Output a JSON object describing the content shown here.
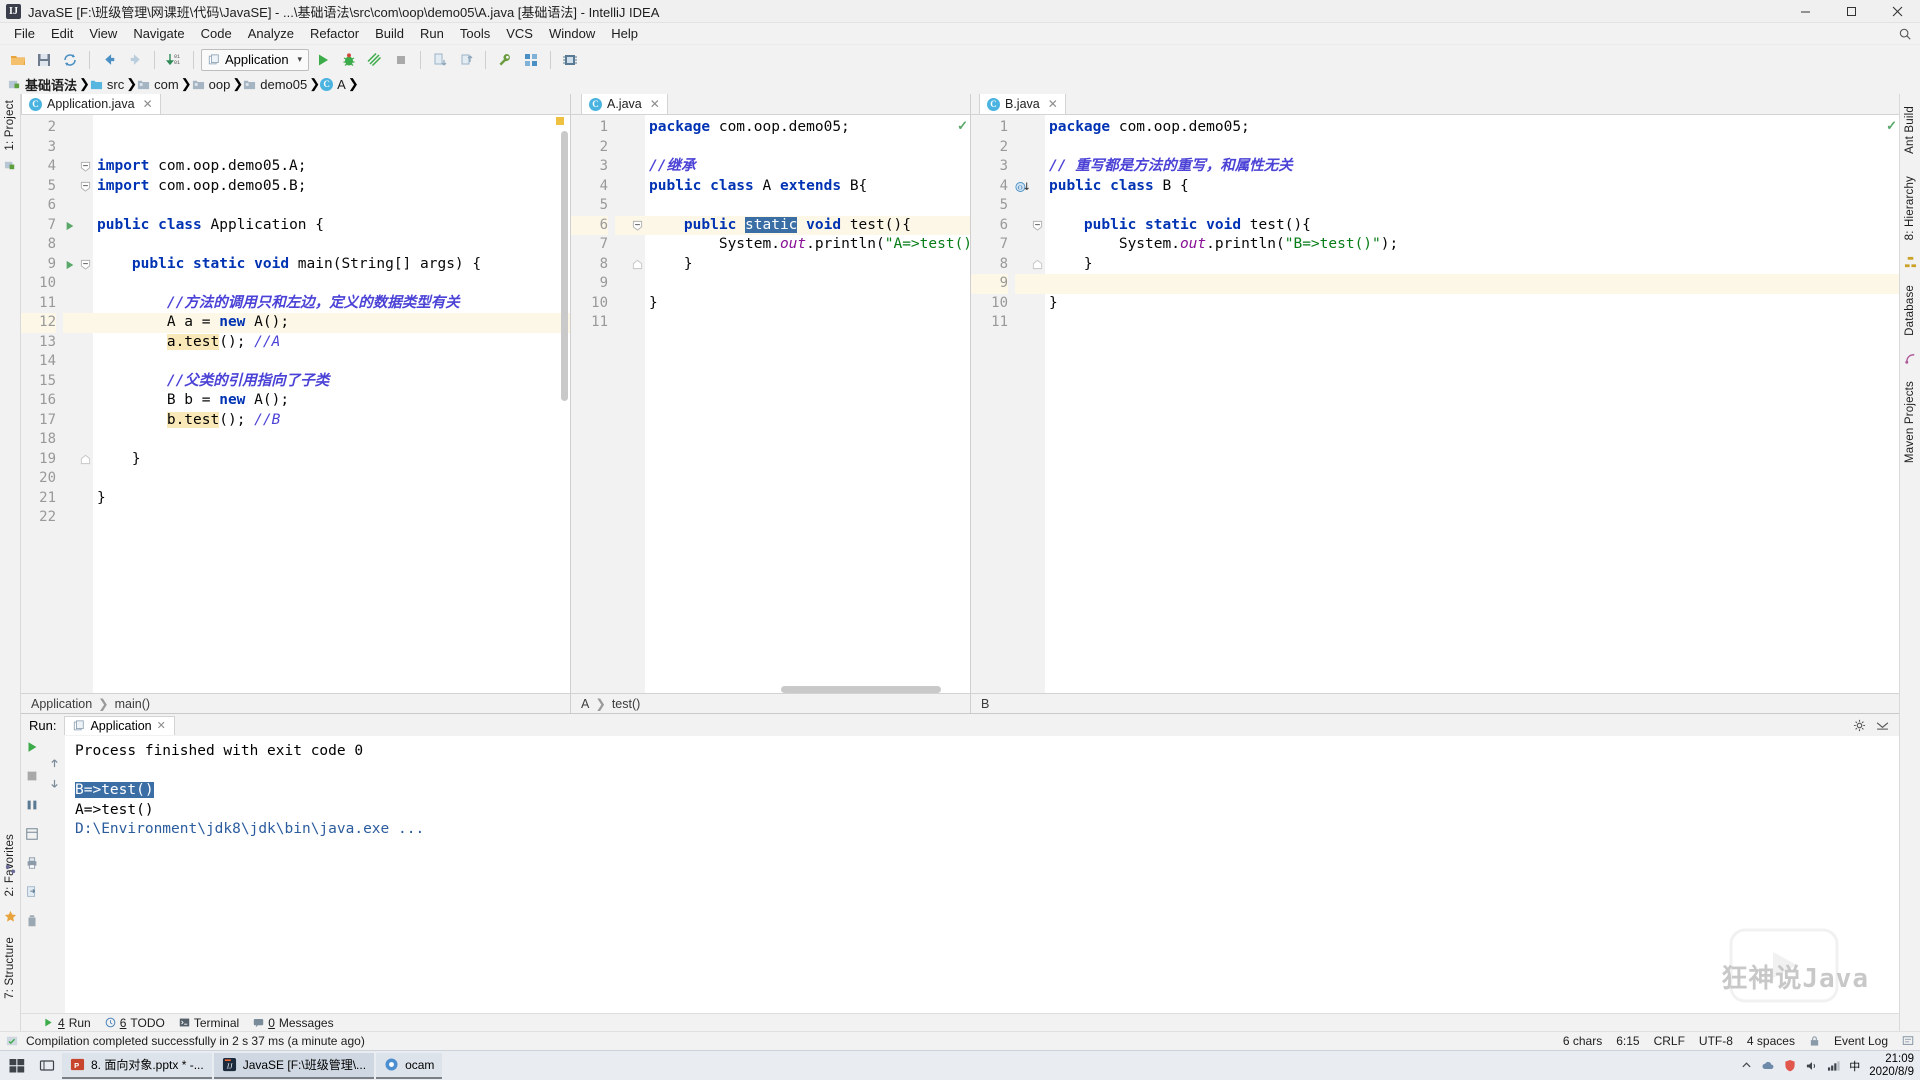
{
  "window": {
    "title": "JavaSE [F:\\班级管理\\网课班\\代码\\JavaSE] - ...\\基础语法\\src\\com\\oop\\demo05\\A.java [基础语法] - IntelliJ IDEA",
    "app_icon": "intellij-idea-icon",
    "minimize": "minimize-icon",
    "maximize": "maximize-icon",
    "close": "close-icon"
  },
  "menubar": {
    "items": [
      "File",
      "Edit",
      "View",
      "Navigate",
      "Code",
      "Analyze",
      "Refactor",
      "Build",
      "Run",
      "Tools",
      "VCS",
      "Window",
      "Help"
    ],
    "search_icon": "search-everywhere-icon"
  },
  "toolbar": {
    "run_config": "Application",
    "buttons": [
      "open-folder-icon",
      "save-all-icon",
      "sync-icon",
      "back-arrow-icon",
      "forward-arrow-icon",
      "compile-icon",
      "run-icon",
      "debug-icon",
      "run-coverage-icon",
      "stop-icon",
      "update-project-icon",
      "commit-icon",
      "settings-wrench-icon",
      "project-structure-icon",
      "sdk-manager-icon"
    ]
  },
  "breadcrumb": {
    "items": [
      {
        "label": "基础语法",
        "icon": "module-icon",
        "bold": true
      },
      {
        "label": "src",
        "icon": "source-folder-icon",
        "bold": false
      },
      {
        "label": "com",
        "icon": "package-folder-icon",
        "bold": false
      },
      {
        "label": "oop",
        "icon": "package-folder-icon",
        "bold": false
      },
      {
        "label": "demo05",
        "icon": "package-folder-icon",
        "bold": false
      },
      {
        "label": "A",
        "icon": "java-class-icon",
        "bold": false
      }
    ]
  },
  "left_strip": {
    "project_label": "1: Project",
    "structure_label": "7: Structure",
    "favorites_label": "2: Favorites"
  },
  "right_strip": {
    "ant_label": "Ant Build",
    "hierarchy_label": "8: Hierarchy",
    "database_label": "Database",
    "maven_label": "Maven Projects"
  },
  "editors": [
    {
      "tab": "Application.java",
      "tab_icon": "java-class-run-icon",
      "breadcrumb": [
        "Application",
        "main()"
      ],
      "first_line": 2,
      "lines": [
        {
          "n": 2,
          "fold": "",
          "gutter": "",
          "hl": false,
          "tokens": []
        },
        {
          "n": 3,
          "fold": "",
          "gutter": "",
          "hl": false,
          "tokens": []
        },
        {
          "n": 4,
          "fold": "collapse",
          "gutter": "",
          "hl": false,
          "tokens": [
            {
              "t": "import ",
              "c": "kw"
            },
            {
              "t": "com.oop.demo05.A;",
              "c": "pl"
            }
          ]
        },
        {
          "n": 5,
          "fold": "collapse",
          "gutter": "",
          "hl": false,
          "tokens": [
            {
              "t": "import ",
              "c": "kw"
            },
            {
              "t": "com.oop.demo05.B;",
              "c": "pl"
            }
          ]
        },
        {
          "n": 6,
          "fold": "",
          "gutter": "",
          "hl": false,
          "tokens": []
        },
        {
          "n": 7,
          "fold": "",
          "gutter": "run",
          "hl": false,
          "tokens": [
            {
              "t": "public class ",
              "c": "kw"
            },
            {
              "t": "Application {",
              "c": "pl"
            }
          ]
        },
        {
          "n": 8,
          "fold": "",
          "gutter": "",
          "hl": false,
          "tokens": []
        },
        {
          "n": 9,
          "fold": "collapse",
          "gutter": "run",
          "hl": false,
          "tokens": [
            {
              "t": "    public static void ",
              "c": "kw"
            },
            {
              "t": "main(String[] args) {",
              "c": "pl"
            }
          ]
        },
        {
          "n": 10,
          "fold": "",
          "gutter": "",
          "hl": false,
          "tokens": []
        },
        {
          "n": 11,
          "fold": "",
          "gutter": "",
          "hl": false,
          "tokens": [
            {
              "t": "        //方法的调用只和左边，定义的数据类型有关",
              "c": "cmz"
            }
          ]
        },
        {
          "n": 12,
          "fold": "",
          "gutter": "",
          "hl": true,
          "tokens": [
            {
              "t": "        A a = ",
              "c": "pl"
            },
            {
              "t": "new ",
              "c": "kw"
            },
            {
              "t": "A();",
              "c": "pl"
            }
          ]
        },
        {
          "n": 13,
          "fold": "",
          "gutter": "",
          "hl": false,
          "tokens": [
            {
              "t": "        ",
              "c": "pl"
            },
            {
              "t": "a.test",
              "c": "methl"
            },
            {
              "t": "(); ",
              "c": "pl"
            },
            {
              "t": "//A",
              "c": "cm"
            }
          ]
        },
        {
          "n": 14,
          "fold": "",
          "gutter": "",
          "hl": false,
          "tokens": []
        },
        {
          "n": 15,
          "fold": "",
          "gutter": "",
          "hl": false,
          "tokens": [
            {
              "t": "        //父类的引用指向了子类",
              "c": "cmz"
            }
          ]
        },
        {
          "n": 16,
          "fold": "",
          "gutter": "",
          "hl": false,
          "tokens": [
            {
              "t": "        B b = ",
              "c": "pl"
            },
            {
              "t": "new ",
              "c": "kw"
            },
            {
              "t": "A();",
              "c": "pl"
            }
          ]
        },
        {
          "n": 17,
          "fold": "",
          "gutter": "",
          "hl": false,
          "tokens": [
            {
              "t": "        ",
              "c": "pl"
            },
            {
              "t": "b.test",
              "c": "methl"
            },
            {
              "t": "(); ",
              "c": "pl"
            },
            {
              "t": "//B",
              "c": "cm"
            }
          ]
        },
        {
          "n": 18,
          "fold": "",
          "gutter": "",
          "hl": false,
          "tokens": []
        },
        {
          "n": 19,
          "fold": "end",
          "gutter": "",
          "hl": false,
          "tokens": [
            {
              "t": "    }",
              "c": "pl"
            }
          ]
        },
        {
          "n": 20,
          "fold": "",
          "gutter": "",
          "hl": false,
          "tokens": []
        },
        {
          "n": 21,
          "fold": "",
          "gutter": "",
          "hl": false,
          "tokens": [
            {
              "t": "}",
              "c": "pl"
            }
          ]
        },
        {
          "n": 22,
          "fold": "",
          "gutter": "",
          "hl": false,
          "tokens": []
        }
      ]
    },
    {
      "tab": "A.java",
      "tab_icon": "java-class-icon",
      "breadcrumb": [
        "A",
        "test()"
      ],
      "first_line": 1,
      "lines": [
        {
          "n": 1,
          "fold": "",
          "gutter": "",
          "hl": false,
          "tokens": [
            {
              "t": "package ",
              "c": "kw"
            },
            {
              "t": "com.oop.demo05;",
              "c": "pl"
            }
          ]
        },
        {
          "n": 2,
          "fold": "",
          "gutter": "",
          "hl": false,
          "tokens": []
        },
        {
          "n": 3,
          "fold": "",
          "gutter": "",
          "hl": false,
          "tokens": [
            {
              "t": "//继承",
              "c": "cmz"
            }
          ]
        },
        {
          "n": 4,
          "fold": "",
          "gutter": "",
          "hl": false,
          "tokens": [
            {
              "t": "public class ",
              "c": "kw"
            },
            {
              "t": "A ",
              "c": "pl"
            },
            {
              "t": "extends ",
              "c": "kw"
            },
            {
              "t": "B{",
              "c": "pl"
            }
          ]
        },
        {
          "n": 5,
          "fold": "",
          "gutter": "",
          "hl": false,
          "tokens": []
        },
        {
          "n": 6,
          "fold": "collapse",
          "gutter": "",
          "hl": true,
          "tokens": [
            {
              "t": "    public ",
              "c": "kw"
            },
            {
              "t": "static",
              "c": "sel"
            },
            {
              "t": " void ",
              "c": "kw"
            },
            {
              "t": "test(){",
              "c": "pl"
            }
          ]
        },
        {
          "n": 7,
          "fold": "",
          "gutter": "",
          "hl": false,
          "tokens": [
            {
              "t": "        System.",
              "c": "pl"
            },
            {
              "t": "out",
              "c": "fld"
            },
            {
              "t": ".println(",
              "c": "pl"
            },
            {
              "t": "\"A=>test()\"",
              "c": "st"
            },
            {
              "t": ");",
              "c": "pl"
            }
          ]
        },
        {
          "n": 8,
          "fold": "end",
          "gutter": "",
          "hl": false,
          "tokens": [
            {
              "t": "    }",
              "c": "pl"
            }
          ]
        },
        {
          "n": 9,
          "fold": "",
          "gutter": "",
          "hl": false,
          "tokens": []
        },
        {
          "n": 10,
          "fold": "",
          "gutter": "",
          "hl": false,
          "tokens": [
            {
              "t": "}",
              "c": "pl"
            }
          ]
        },
        {
          "n": 11,
          "fold": "",
          "gutter": "",
          "hl": false,
          "tokens": []
        }
      ]
    },
    {
      "tab": "B.java",
      "tab_icon": "java-class-icon",
      "breadcrumb": [
        "B"
      ],
      "first_line": 1,
      "lines": [
        {
          "n": 1,
          "fold": "",
          "gutter": "",
          "hl": false,
          "tokens": [
            {
              "t": "package ",
              "c": "kw"
            },
            {
              "t": "com.oop.demo05;",
              "c": "pl"
            }
          ]
        },
        {
          "n": 2,
          "fold": "",
          "gutter": "",
          "hl": false,
          "tokens": []
        },
        {
          "n": 3,
          "fold": "",
          "gutter": "",
          "hl": false,
          "tokens": [
            {
              "t": "// 重写都是方法的重写，和属性无关",
              "c": "cmz"
            }
          ]
        },
        {
          "n": 4,
          "fold": "",
          "gutter": "overridden",
          "hl": false,
          "tokens": [
            {
              "t": "public class ",
              "c": "kw"
            },
            {
              "t": "B {",
              "c": "pl"
            }
          ]
        },
        {
          "n": 5,
          "fold": "",
          "gutter": "",
          "hl": false,
          "tokens": []
        },
        {
          "n": 6,
          "fold": "collapse",
          "gutter": "",
          "hl": false,
          "tokens": [
            {
              "t": "    public static void ",
              "c": "kw"
            },
            {
              "t": "test(){",
              "c": "pl"
            }
          ]
        },
        {
          "n": 7,
          "fold": "",
          "gutter": "",
          "hl": false,
          "tokens": [
            {
              "t": "        System.",
              "c": "pl"
            },
            {
              "t": "out",
              "c": "fld"
            },
            {
              "t": ".println(",
              "c": "pl"
            },
            {
              "t": "\"B=>test()\"",
              "c": "st"
            },
            {
              "t": ");",
              "c": "pl"
            }
          ]
        },
        {
          "n": 8,
          "fold": "end",
          "gutter": "",
          "hl": false,
          "tokens": [
            {
              "t": "    }",
              "c": "pl"
            }
          ]
        },
        {
          "n": 9,
          "fold": "",
          "gutter": "",
          "hl": true,
          "tokens": []
        },
        {
          "n": 10,
          "fold": "",
          "gutter": "",
          "hl": false,
          "tokens": [
            {
              "t": "}",
              "c": "pl"
            }
          ]
        },
        {
          "n": 11,
          "fold": "",
          "gutter": "",
          "hl": false,
          "tokens": []
        }
      ]
    }
  ],
  "run_window": {
    "label": "Run:",
    "tab": "Application",
    "tab_icon": "run-config-icon",
    "settings_icon": "gear-icon",
    "minimize_icon": "hide-icon",
    "side_buttons": [
      "rerun-icon",
      "stop-icon",
      "pause-icon",
      "restore-layout-icon",
      "print-icon",
      "export-icon",
      "trash-icon"
    ],
    "side_arrows": [
      "scroll-up-icon",
      "scroll-down-icon"
    ],
    "console": [
      {
        "text": "D:\\Environment\\jdk8\\jdk\\bin\\java.exe ...",
        "style": "path"
      },
      {
        "text": "A=>test()",
        "style": "plain"
      },
      {
        "text": "B=>test()",
        "style": "selected"
      },
      {
        "text": "",
        "style": "plain"
      },
      {
        "text": "Process finished with exit code 0",
        "style": "plain"
      }
    ]
  },
  "bottom_tools": [
    {
      "num": "4",
      "label": "Run",
      "icon": "run-icon"
    },
    {
      "num": "6",
      "label": "TODO",
      "icon": "todo-icon"
    },
    {
      "num": "",
      "label": "Terminal",
      "icon": "terminal-icon"
    },
    {
      "num": "0",
      "label": "Messages",
      "icon": "messages-icon"
    }
  ],
  "statusbar": {
    "message": "Compilation completed successfully in 2 s 37 ms (a minute ago)",
    "chars": "6 chars",
    "position": "6:15",
    "line_ending": "CRLF",
    "encoding": "UTF-8",
    "indent": "4 spaces",
    "lock_icon": "lock-icon",
    "event_log": "Event Log",
    "event_log_icon": "event-log-icon"
  },
  "taskbar": {
    "start_icon": "windows-start-icon",
    "search_icon": "task-view-icon",
    "items": [
      {
        "label": "8. 面向对象.pptx * -...",
        "icon": "powerpoint-icon",
        "active": false
      },
      {
        "label": "JavaSE [F:\\班级管理\\...",
        "icon": "intellij-icon",
        "active": true
      },
      {
        "label": "ocam",
        "icon": "ocam-icon",
        "active": false
      }
    ],
    "tray_icons": [
      "chevron-up-icon",
      "cloud-icon",
      "shield-icon",
      "volume-icon",
      "network-icon",
      "ime-icon"
    ],
    "clock_time": "21:09",
    "clock_date": "2020/8/9"
  },
  "colors": {
    "accent": "#4ab3e0",
    "keyword": "#0033b3",
    "string": "#067d17",
    "comment": "#4b42d6",
    "selection": "#3a6ea5",
    "highlight_line": "#fcf7e6",
    "method_highlight": "#fae9b8"
  }
}
